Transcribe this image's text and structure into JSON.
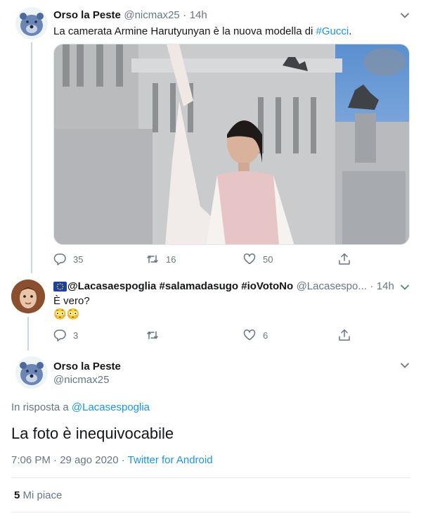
{
  "tweet1": {
    "display_name": "Orso la Peste",
    "handle": "@nicmax25",
    "dot": "·",
    "time": "14h",
    "text_prefix": "La camerata Armine Harutyunyan è la nuova modella di ",
    "hashtag": "#Gucci",
    "text_suffix": ".",
    "replies": "35",
    "retweets": "16",
    "likes": "50"
  },
  "tweet2": {
    "display_name": "@Lacasaespoglia #salamadasugo #ioVotoNo",
    "handle": "@Lacasespo...",
    "dot": "·",
    "time": "14h",
    "text": "È vero?",
    "emoji": "😳😳",
    "replies": "3",
    "retweets": "",
    "likes": "6"
  },
  "main_tweet": {
    "display_name": "Orso la Peste",
    "handle": "@nicmax25",
    "reply_prefix": "In risposta a ",
    "reply_to": "@Lacasespoglia",
    "text": "La foto è inequivocabile",
    "timestamp": "7:06 PM · 29 ago 2020 · ",
    "source": "Twitter for Android",
    "likes_count": "5",
    "likes_label": "Mi piace"
  },
  "colors": {
    "link": "#1b95e0",
    "muted": "#657786",
    "divider": "#e6ecf0"
  }
}
